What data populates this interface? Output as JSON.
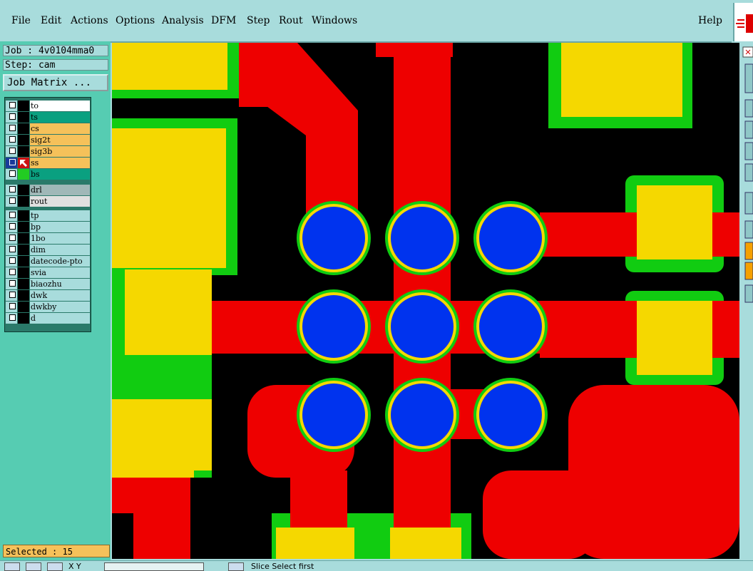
{
  "menu": {
    "items": [
      "File",
      "Edit",
      "Actions",
      "Options",
      "Analysis",
      "DFM",
      "Step",
      "Rout",
      "Windows"
    ],
    "help": "Help"
  },
  "job": {
    "label": "Job : 4v0104mma0",
    "step": "Step: cam",
    "matrix_button": "Job Matrix ..."
  },
  "layers": [
    {
      "name": "to",
      "bg": "#ffffff",
      "color": "#000000"
    },
    {
      "name": "ts",
      "bg": "#0aa080",
      "color": "#000000"
    },
    {
      "name": "cs",
      "bg": "#f5c15a",
      "color": "#000000"
    },
    {
      "name": "sig2t",
      "bg": "#f5c15a",
      "color": "#000000"
    },
    {
      "name": "sig3b",
      "bg": "#f5c15a",
      "color": "#000000"
    },
    {
      "name": "ss",
      "bg": "#f5c15a",
      "color": "#000000",
      "active": true
    },
    {
      "name": "bs",
      "bg": "#0aa080",
      "color": "#22cc22"
    },
    {
      "name": "drl",
      "bg": "#a0b8b8",
      "color": "#000000"
    },
    {
      "name": "rout",
      "bg": "#e0e0e0",
      "color": "#000000"
    },
    {
      "name": "tp",
      "bg": "#a8dcdc",
      "color": "#000000"
    },
    {
      "name": "bp",
      "bg": "#a8dcdc",
      "color": "#000000"
    },
    {
      "name": "1bo",
      "bg": "#a8dcdc",
      "color": "#000000"
    },
    {
      "name": "dim",
      "bg": "#a8dcdc",
      "color": "#000000"
    },
    {
      "name": "datecode-pto",
      "bg": "#a8dcdc",
      "color": "#000000"
    },
    {
      "name": "svia",
      "bg": "#a8dcdc",
      "color": "#000000"
    },
    {
      "name": "biaozhu",
      "bg": "#a8dcdc",
      "color": "#000000"
    },
    {
      "name": "dwk",
      "bg": "#a8dcdc",
      "color": "#000000"
    },
    {
      "name": "dwkby",
      "bg": "#a8dcdc",
      "color": "#000000"
    },
    {
      "name": "d",
      "bg": "#a8dcdc",
      "color": "#000000"
    }
  ],
  "selected_text": "Selected : 15",
  "status": {
    "coords": "X Y",
    "message": "Slice Select first"
  },
  "colors": {
    "copper": "#ee0000",
    "pad": "#f5d800",
    "mask": "#11cc11",
    "drill": "#0033ee",
    "background": "#000000"
  }
}
